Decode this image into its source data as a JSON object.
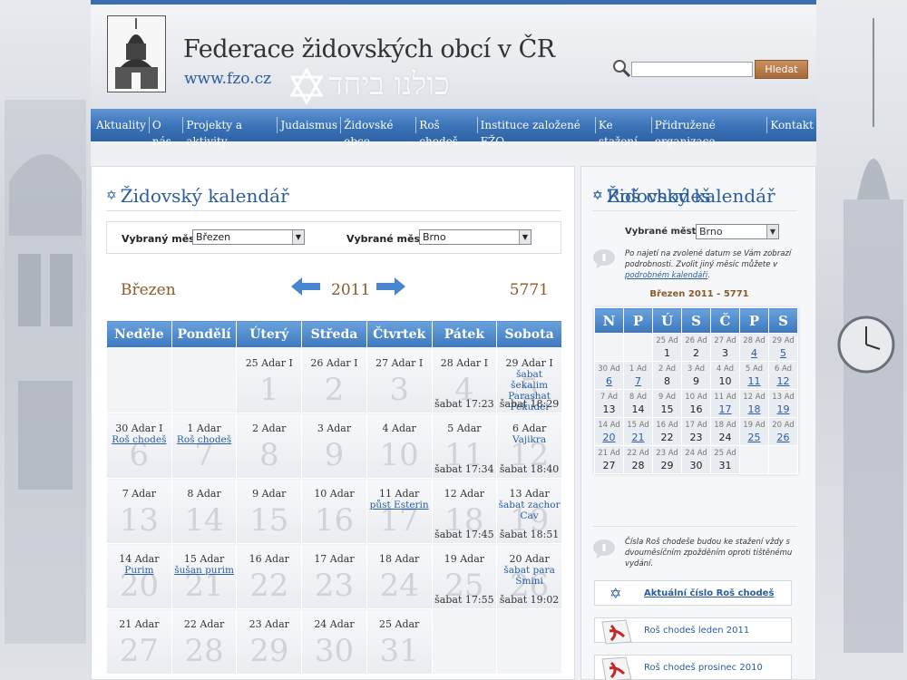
{
  "header": {
    "title": "Federace židovských obcí v ČR",
    "url": "www.fzo.cz",
    "hebrew": "כולנו ביחד",
    "search_button": "Hledat",
    "search_value": ""
  },
  "nav": [
    "Aktuality",
    "O nás",
    "Projekty a aktivity",
    "Judaismus",
    "Židovské obce",
    "Roš chodeš",
    "Instituce založené FŽO",
    "Ke stažení",
    "Přidružené organizace",
    "Kontakt"
  ],
  "main": {
    "title": "Židovský kalendář",
    "month_label": "Vybraný měsíc:",
    "month_value": "Březen",
    "city_label": "Vybrané město:",
    "city_value": "Brno",
    "month_name": "Březen",
    "year": "2011",
    "hebrew_year": "5771",
    "weekdays": [
      "Neděle",
      "Pondělí",
      "Úterý",
      "Středa",
      "Čtvrtek",
      "Pátek",
      "Sobota"
    ],
    "weeks": [
      [
        {
          "empty": true
        },
        {
          "empty": true
        },
        {
          "heb": "25 Adar I",
          "num": "1"
        },
        {
          "heb": "26 Adar I",
          "num": "2"
        },
        {
          "heb": "27 Adar I",
          "num": "3"
        },
        {
          "heb": "28 Adar I",
          "num": "4",
          "shabbat": "šabat 17:23"
        },
        {
          "heb": "29 Adar I",
          "num": "5",
          "events": [
            "šabat šekalim",
            "Parashat Pekudei"
          ],
          "shabbat": "šabat 18:29"
        }
      ],
      [
        {
          "heb": "30 Adar I",
          "num": "6",
          "events": [
            "Roš chodeš"
          ],
          "link": true
        },
        {
          "heb": "1 Adar",
          "num": "7",
          "events": [
            "Roš chodeš"
          ],
          "link": true
        },
        {
          "heb": "2 Adar",
          "num": "8"
        },
        {
          "heb": "3 Adar",
          "num": "9"
        },
        {
          "heb": "4 Adar",
          "num": "10"
        },
        {
          "heb": "5 Adar",
          "num": "11",
          "shabbat": "šabat 17:34"
        },
        {
          "heb": "6 Adar",
          "num": "12",
          "events": [
            "Vajikra"
          ],
          "shabbat": "šabat 18:40"
        }
      ],
      [
        {
          "heb": "7 Adar",
          "num": "13"
        },
        {
          "heb": "8 Adar",
          "num": "14"
        },
        {
          "heb": "9 Adar",
          "num": "15"
        },
        {
          "heb": "10 Adar",
          "num": "16"
        },
        {
          "heb": "11 Adar",
          "num": "17",
          "events": [
            "půst Esterin"
          ],
          "link": true
        },
        {
          "heb": "12 Adar",
          "num": "18",
          "shabbat": "šabat 17:45"
        },
        {
          "heb": "13 Adar",
          "num": "19",
          "events": [
            "šabat zachor",
            "Cav"
          ],
          "shabbat": "šabat 18:51"
        }
      ],
      [
        {
          "heb": "14 Adar",
          "num": "20",
          "events": [
            "Purim"
          ],
          "link": true
        },
        {
          "heb": "15 Adar",
          "num": "21",
          "events": [
            "šušan purim"
          ],
          "link": true
        },
        {
          "heb": "16 Adar",
          "num": "22"
        },
        {
          "heb": "17 Adar",
          "num": "23"
        },
        {
          "heb": "18 Adar",
          "num": "24"
        },
        {
          "heb": "19 Adar",
          "num": "25",
          "shabbat": "šabat 17:55"
        },
        {
          "heb": "20 Adar",
          "num": "26",
          "events": [
            "šabat para",
            "Šmini"
          ],
          "shabbat": "šabat 19:02"
        }
      ],
      [
        {
          "heb": "21 Adar",
          "num": "27"
        },
        {
          "heb": "22 Adar",
          "num": "28"
        },
        {
          "heb": "23 Adar",
          "num": "29"
        },
        {
          "heb": "24 Adar",
          "num": "30"
        },
        {
          "heb": "25 Adar",
          "num": "31"
        },
        {
          "empty": true
        },
        {
          "empty": true
        }
      ]
    ]
  },
  "side": {
    "title": "Židovský kalendář",
    "city_label": "Vybrané město:",
    "city_value": "Brno",
    "info1": "Po najetí na zvolené datum se Vám zobrazí podrobnosti. Zvolit jiný měsíc můžete v",
    "info1_link": "podrobném kalendáři",
    "mini_title": "Březen 2011 - 5771",
    "mini_weekdays": [
      "N",
      "P",
      "Ú",
      "S",
      "Č",
      "P",
      "S"
    ],
    "mini_weeks": [
      [
        {
          "empty": true
        },
        {
          "empty": true
        },
        {
          "h": "25 Ad",
          "d": "1"
        },
        {
          "h": "26 Ad",
          "d": "2"
        },
        {
          "h": "27 Ad",
          "d": "3"
        },
        {
          "h": "28 Ad",
          "d": "4",
          "l": true
        },
        {
          "h": "29 Ad",
          "d": "5",
          "l": true
        }
      ],
      [
        {
          "h": "30 Ad",
          "d": "6",
          "l": true
        },
        {
          "h": "1 Ad",
          "d": "7",
          "l": true
        },
        {
          "h": "2 Ad",
          "d": "8"
        },
        {
          "h": "3 Ad",
          "d": "9"
        },
        {
          "h": "4 Ad",
          "d": "10"
        },
        {
          "h": "5 Ad",
          "d": "11",
          "l": true
        },
        {
          "h": "6 Ad",
          "d": "12",
          "l": true
        }
      ],
      [
        {
          "h": "7 Ad",
          "d": "13"
        },
        {
          "h": "8 Ad",
          "d": "14"
        },
        {
          "h": "9 Ad",
          "d": "15"
        },
        {
          "h": "10 Ad",
          "d": "16"
        },
        {
          "h": "11 Ad",
          "d": "17",
          "l": true
        },
        {
          "h": "12 Ad",
          "d": "18",
          "l": true
        },
        {
          "h": "13 Ad",
          "d": "19",
          "l": true
        }
      ],
      [
        {
          "h": "14 Ad",
          "d": "20",
          "l": true
        },
        {
          "h": "15 Ad",
          "d": "21",
          "l": true
        },
        {
          "h": "16 Ad",
          "d": "22"
        },
        {
          "h": "17 Ad",
          "d": "23"
        },
        {
          "h": "18 Ad",
          "d": "24"
        },
        {
          "h": "19 Ad",
          "d": "25",
          "l": true
        },
        {
          "h": "20 Ad",
          "d": "26",
          "l": true
        }
      ],
      [
        {
          "h": "21 Ad",
          "d": "27"
        },
        {
          "h": "22 Ad",
          "d": "28"
        },
        {
          "h": "23 Ad",
          "d": "29"
        },
        {
          "h": "24 Ad",
          "d": "30"
        },
        {
          "h": "25 Ad",
          "d": "31"
        },
        {
          "empty": true
        },
        {
          "empty": true
        }
      ]
    ],
    "ros_title": "Roš chodeš",
    "ros_info": "Čísla Roš chodeše budou ke stažení vždy s dvouměsíčním zpožděním oproti tištěnému vydání.",
    "ros_current": "Aktuální číslo Roš chodeš",
    "ros_items": [
      "Roš chodeš leden 2011",
      "Roš chodeš prosinec 2010"
    ]
  },
  "colors": {
    "accent": "#2a5d9f",
    "nav": "#3a72b7",
    "brown": "#8b5a2b"
  }
}
